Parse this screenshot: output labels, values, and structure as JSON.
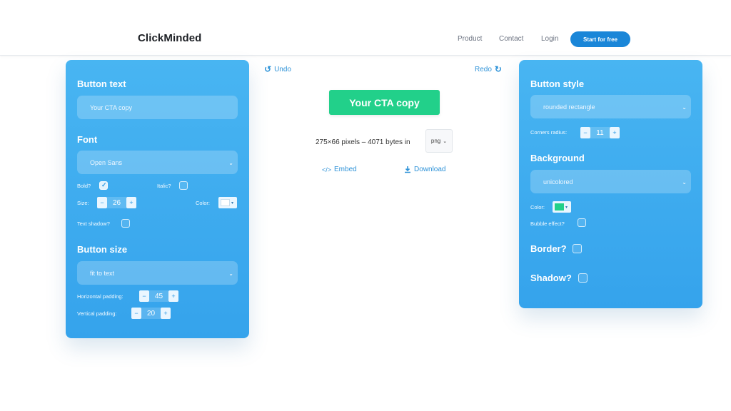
{
  "header": {
    "logo": "ClickMinded",
    "nav": [
      "Product",
      "Contact",
      "Login"
    ],
    "cta": "Start for free"
  },
  "toolbar": {
    "undo": "Undo",
    "redo": "Redo"
  },
  "preview": {
    "button_text": "Your CTA copy",
    "button_color": "#22d08a",
    "info": "275×66 pixels – 4071 bytes in",
    "format": "png",
    "embed": "Embed",
    "download": "Download"
  },
  "left_panel": {
    "button_text_heading": "Button text",
    "button_text_value": "Your CTA copy",
    "font_heading": "Font",
    "font_value": "Open Sans",
    "bold_label": "Bold?",
    "bold_checked": true,
    "italic_label": "Italic?",
    "italic_checked": false,
    "size_label": "Size:",
    "size_value": "26",
    "color_label": "Color:",
    "font_color": "#ffffff",
    "shadow_label": "Text shadow?",
    "button_size_heading": "Button size",
    "size_mode": "fit to text",
    "hpad_label": "Horizontal padding:",
    "hpad_value": "45",
    "vpad_label": "Vertical padding:",
    "vpad_value": "20"
  },
  "right_panel": {
    "style_heading": "Button style",
    "style_value": "rounded rectangle",
    "radius_label": "Corners radius:",
    "radius_value": "11",
    "background_heading": "Background",
    "background_value": "unicolored",
    "color_label": "Color:",
    "bg_color": "#22d08a",
    "bubble_label": "Bubble effect?",
    "border_heading": "Border?",
    "shadow_heading": "Shadow?"
  },
  "colors": {
    "accent": "#1a86d8",
    "panel": "#3aa8ee",
    "cta_green": "#22d08a"
  }
}
